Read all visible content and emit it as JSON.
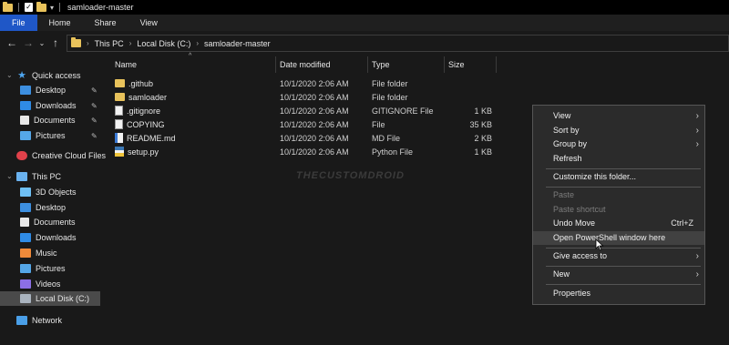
{
  "window": {
    "title": "samloader-master"
  },
  "ribbon": {
    "tabs": [
      "File",
      "Home",
      "Share",
      "View"
    ]
  },
  "address": {
    "crumbs": [
      "This PC",
      "Local Disk (C:)",
      "samloader-master"
    ]
  },
  "sidebar": {
    "items": [
      {
        "label": "Quick access",
        "icon": "star-icon",
        "pinned": false
      },
      {
        "label": "Desktop",
        "icon": "desktop-icon",
        "pinned": true
      },
      {
        "label": "Downloads",
        "icon": "downloads-icon",
        "pinned": true
      },
      {
        "label": "Documents",
        "icon": "documents-icon",
        "pinned": true
      },
      {
        "label": "Pictures",
        "icon": "pictures-icon",
        "pinned": true
      },
      {
        "label": "Creative Cloud Files",
        "icon": "creative-cloud-icon",
        "pinned": false
      },
      {
        "label": "This PC",
        "icon": "computer-icon",
        "pinned": false
      },
      {
        "label": "3D Objects",
        "icon": "3d-objects-icon",
        "pinned": false
      },
      {
        "label": "Desktop",
        "icon": "desktop-icon",
        "pinned": false
      },
      {
        "label": "Documents",
        "icon": "documents-icon",
        "pinned": false
      },
      {
        "label": "Downloads",
        "icon": "downloads-icon",
        "pinned": false
      },
      {
        "label": "Music",
        "icon": "music-icon",
        "pinned": false
      },
      {
        "label": "Pictures",
        "icon": "pictures-icon",
        "pinned": false
      },
      {
        "label": "Videos",
        "icon": "videos-icon",
        "pinned": false
      },
      {
        "label": "Local Disk (C:)",
        "icon": "disk-icon",
        "pinned": false,
        "selected": true
      },
      {
        "label": "Network",
        "icon": "network-icon",
        "pinned": false
      }
    ]
  },
  "columns": {
    "name": "Name",
    "date": "Date modified",
    "type": "Type",
    "size": "Size"
  },
  "files": [
    {
      "name": ".github",
      "date": "10/1/2020 2:06 AM",
      "type": "File folder",
      "size": "",
      "icon": "folder-icon"
    },
    {
      "name": "samloader",
      "date": "10/1/2020 2:06 AM",
      "type": "File folder",
      "size": "",
      "icon": "folder-icon"
    },
    {
      "name": ".gitignore",
      "date": "10/1/2020 2:06 AM",
      "type": "GITIGNORE File",
      "size": "1 KB",
      "icon": "file-icon"
    },
    {
      "name": "COPYING",
      "date": "10/1/2020 2:06 AM",
      "type": "File",
      "size": "35 KB",
      "icon": "file-icon"
    },
    {
      "name": "README.md",
      "date": "10/1/2020 2:06 AM",
      "type": "MD File",
      "size": "2 KB",
      "icon": "markdown-file-icon"
    },
    {
      "name": "setup.py",
      "date": "10/1/2020 2:06 AM",
      "type": "Python File",
      "size": "1 KB",
      "icon": "python-file-icon"
    }
  ],
  "watermark": "THECUSTOMDROID",
  "context_menu": {
    "items": [
      {
        "label": "View",
        "submenu": true
      },
      {
        "label": "Sort by",
        "submenu": true
      },
      {
        "label": "Group by",
        "submenu": true
      },
      {
        "label": "Refresh"
      },
      {
        "label": "Customize this folder..."
      },
      {
        "label": "Paste",
        "disabled": true
      },
      {
        "label": "Paste shortcut",
        "disabled": true
      },
      {
        "label": "Undo Move",
        "shortcut": "Ctrl+Z"
      },
      {
        "label": "Open PowerShell window here",
        "hover": true
      },
      {
        "label": "Give access to",
        "submenu": true
      },
      {
        "label": "New",
        "submenu": true
      },
      {
        "label": "Properties"
      }
    ]
  },
  "colors": {
    "file_tab": "#1f57c7",
    "background": "#191919",
    "menu": "#2b2b2b"
  }
}
